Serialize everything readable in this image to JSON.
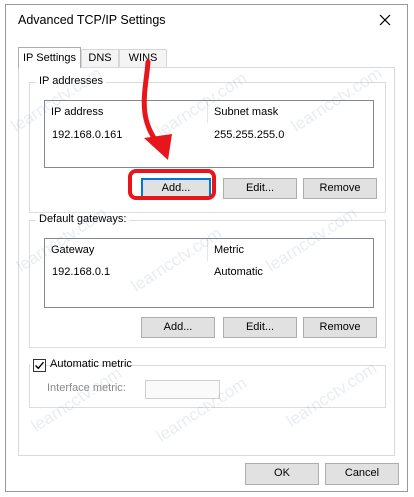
{
  "window": {
    "title": "Advanced TCP/IP Settings"
  },
  "tabs": [
    {
      "label": "IP Settings",
      "active": true
    },
    {
      "label": "DNS",
      "active": false
    },
    {
      "label": "WINS",
      "active": false
    }
  ],
  "ip_addresses": {
    "title": "IP addresses",
    "columns": [
      "IP address",
      "Subnet mask"
    ],
    "rows": [
      {
        "ip": "192.168.0.161",
        "mask": "255.255.255.0"
      }
    ],
    "buttons": {
      "add": "Add...",
      "edit": "Edit...",
      "remove": "Remove"
    }
  },
  "default_gateways": {
    "title": "Default gateways:",
    "columns": [
      "Gateway",
      "Metric"
    ],
    "rows": [
      {
        "gateway": "192.168.0.1",
        "metric": "Automatic"
      }
    ],
    "buttons": {
      "add": "Add...",
      "edit": "Edit...",
      "remove": "Remove"
    }
  },
  "metric": {
    "automatic_label": "Automatic metric",
    "automatic_checked": true,
    "interface_label": "Interface metric:",
    "interface_value": ""
  },
  "footer": {
    "ok": "OK",
    "cancel": "Cancel"
  },
  "watermark": "learncctv.com",
  "colors": {
    "highlight": "#e8161b",
    "default_button_border": "#0078d7"
  }
}
